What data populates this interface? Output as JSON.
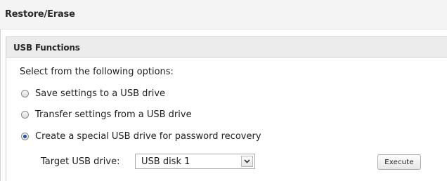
{
  "page": {
    "title": "Restore/Erase"
  },
  "panel": {
    "title": "USB Functions",
    "intro": "Select from the following options:",
    "options": [
      {
        "label": "Save settings to a USB drive",
        "checked": false
      },
      {
        "label": "Transfer settings from a USB drive",
        "checked": false
      },
      {
        "label": "Create a special USB drive for password recovery",
        "checked": true
      }
    ],
    "target": {
      "label": "Target USB drive:",
      "selected": "USB disk 1"
    },
    "execute_label": "Execute"
  },
  "colors": {
    "header_bg": "#f4f4f4",
    "panel_header_bg": "#ececec",
    "radio_dot": "#1f4fa0",
    "border": "#cfcfcf"
  },
  "icons": {
    "dropdown": "chevron-down-icon"
  }
}
